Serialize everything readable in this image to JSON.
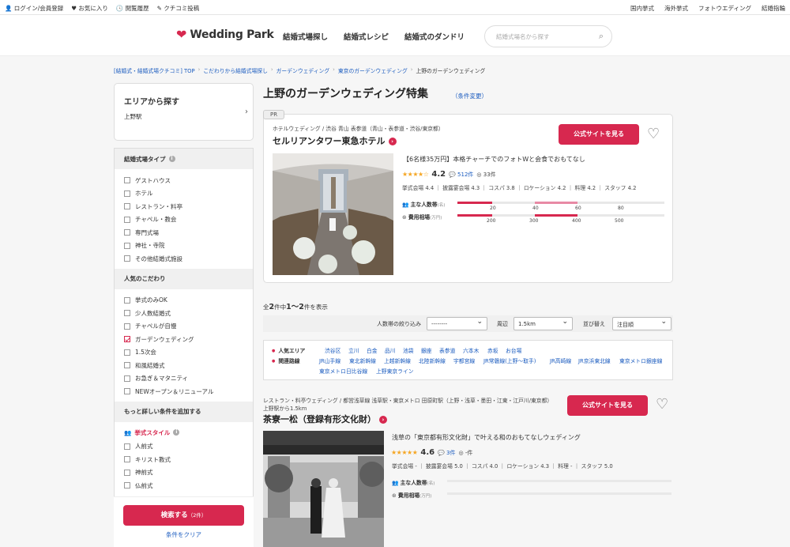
{
  "topbar": {
    "login": "ログイン/会員登録",
    "favorites": "お気に入り",
    "history": "閲覧履歴",
    "review_post": "クチコミ投稿",
    "tabs": [
      "国内挙式",
      "海外挙式",
      "フォトウエディング",
      "結婚指輪"
    ]
  },
  "header": {
    "logo": "Wedding Park",
    "nav": [
      "結婚式場探し",
      "結婚式レシピ",
      "結婚式のダンドリ"
    ],
    "search_placeholder": "結婚式場名から探す"
  },
  "breadcrumb": [
    "[結婚式・結婚式場クチコミ] TOP",
    "こだわりから結婚式場探し",
    "ガーデンウェディング",
    "東京のガーデンウェディング",
    "上野のガーデンウェディング"
  ],
  "sidebar": {
    "area_title": "エリアから探す",
    "area_value": "上野駅",
    "type_title": "結婚式場タイプ",
    "types": [
      {
        "label": "ゲストハウス",
        "checked": false
      },
      {
        "label": "ホテル",
        "checked": false
      },
      {
        "label": "レストラン・料亭",
        "checked": false
      },
      {
        "label": "チャペル・教会",
        "checked": false
      },
      {
        "label": "専門式場",
        "checked": false
      },
      {
        "label": "神社・寺院",
        "checked": false
      },
      {
        "label": "その他結婚式施設",
        "checked": false
      }
    ],
    "pref_title": "人気のこだわり",
    "prefs": [
      {
        "label": "挙式のみOK",
        "checked": false
      },
      {
        "label": "少人数結婚式",
        "checked": false
      },
      {
        "label": "チャペルが自慢",
        "checked": false
      },
      {
        "label": "ガーデンウェディング",
        "checked": true
      },
      {
        "label": "1.5次会",
        "checked": false
      },
      {
        "label": "和風結婚式",
        "checked": false
      },
      {
        "label": "お急ぎ＆マタニティ",
        "checked": false
      },
      {
        "label": "NEWオープン＆リニューアル",
        "checked": false
      }
    ],
    "more_title": "もっと詳しい条件を追加する",
    "style_title": "挙式スタイル",
    "styles": [
      {
        "label": "人前式",
        "checked": false
      },
      {
        "label": "キリスト教式",
        "checked": false
      },
      {
        "label": "神前式",
        "checked": false
      },
      {
        "label": "仏前式",
        "checked": false
      }
    ],
    "search_button": "検索する",
    "search_count": "（2件）",
    "clear": "条件をクリア"
  },
  "main": {
    "title": "上野のガーデンウェディング特集",
    "change": "（条件変更）",
    "result_text_prefix": "全",
    "result_total": "2",
    "result_mid": "件中",
    "result_range": "1〜2",
    "result_suffix": "件を表示",
    "filters": {
      "people_label": "人数帯の絞り込み",
      "people_value": "--------",
      "near_label": "周辺",
      "near_value": "1.5km",
      "sort_label": "並び替え",
      "sort_value": "注目順"
    },
    "popular_area_label": "人気エリア",
    "popular_areas": [
      "渋谷区",
      "立川",
      "白金",
      "品川",
      "池袋",
      "銀座",
      "表参道",
      "六本木",
      "赤坂",
      "お台場"
    ],
    "lines_label": "関連路線",
    "lines_row1": [
      "JR山手線",
      "東北新幹線",
      "上越新幹線",
      "北陸新幹線",
      "宇都宮線",
      "JR常磐線(上野〜取手)",
      "JR高崎線",
      "JR京浜東北線",
      "東京メトロ銀座線"
    ],
    "lines_row2": [
      "東京メトロ日比谷線",
      "上野東京ライン"
    ]
  },
  "venues": [
    {
      "pr": "PR",
      "category": "ホテルウェディング / 渋谷 青山 表参道（青山・表参道・渋谷/東京都）",
      "name": "セルリアンタワー東急ホテル",
      "official": "公式サイトを見る",
      "catch": "【6名様35万円】本格チャーチでのフォトWと会食でおもてなし",
      "stars": "★★★★☆",
      "rating": "4.2",
      "reviews": "512件",
      "photos": "33件",
      "sub_scores": "挙式会場 4.4 ｜ 披露宴会場 4.3 ｜ コスパ 3.8 ｜ ロケーション 4.2 ｜ 料理 4.2 ｜ スタッフ 4.2",
      "guests_label": "主な人数帯",
      "guests_unit": "(名)",
      "guest_ticks": [
        "20",
        "40",
        "60",
        "80"
      ],
      "cost_label": "費用相場",
      "cost_unit": "(万円)",
      "cost_ticks": [
        "200",
        "300",
        "400",
        "500"
      ]
    },
    {
      "category": "レストラン・料亭ウェディング / 都営浅草線 浅草駅・東京メトロ 田原町駅（上野・浅草・墨田・江東・江戸川/東京都）",
      "distance": "上野駅から1.5km",
      "name": "茶寮一松（登録有形文化財）",
      "official": "公式サイトを見る",
      "catch": "浅草の「東京都有形文化財」で叶える和のおもてなしウェディング",
      "stars": "★★★★★",
      "rating": "4.6",
      "reviews": "3件",
      "photos": "-件",
      "sub_scores": "挙式会場 - ｜ 披露宴会場 5.0 ｜ コスパ 4.0 ｜ ロケーション 4.3 ｜ 料理 - ｜ スタッフ 5.0",
      "guests_label": "主な人数帯",
      "guests_unit": "(名)",
      "cost_label": "費用相場",
      "cost_unit": "(万円)"
    }
  ]
}
